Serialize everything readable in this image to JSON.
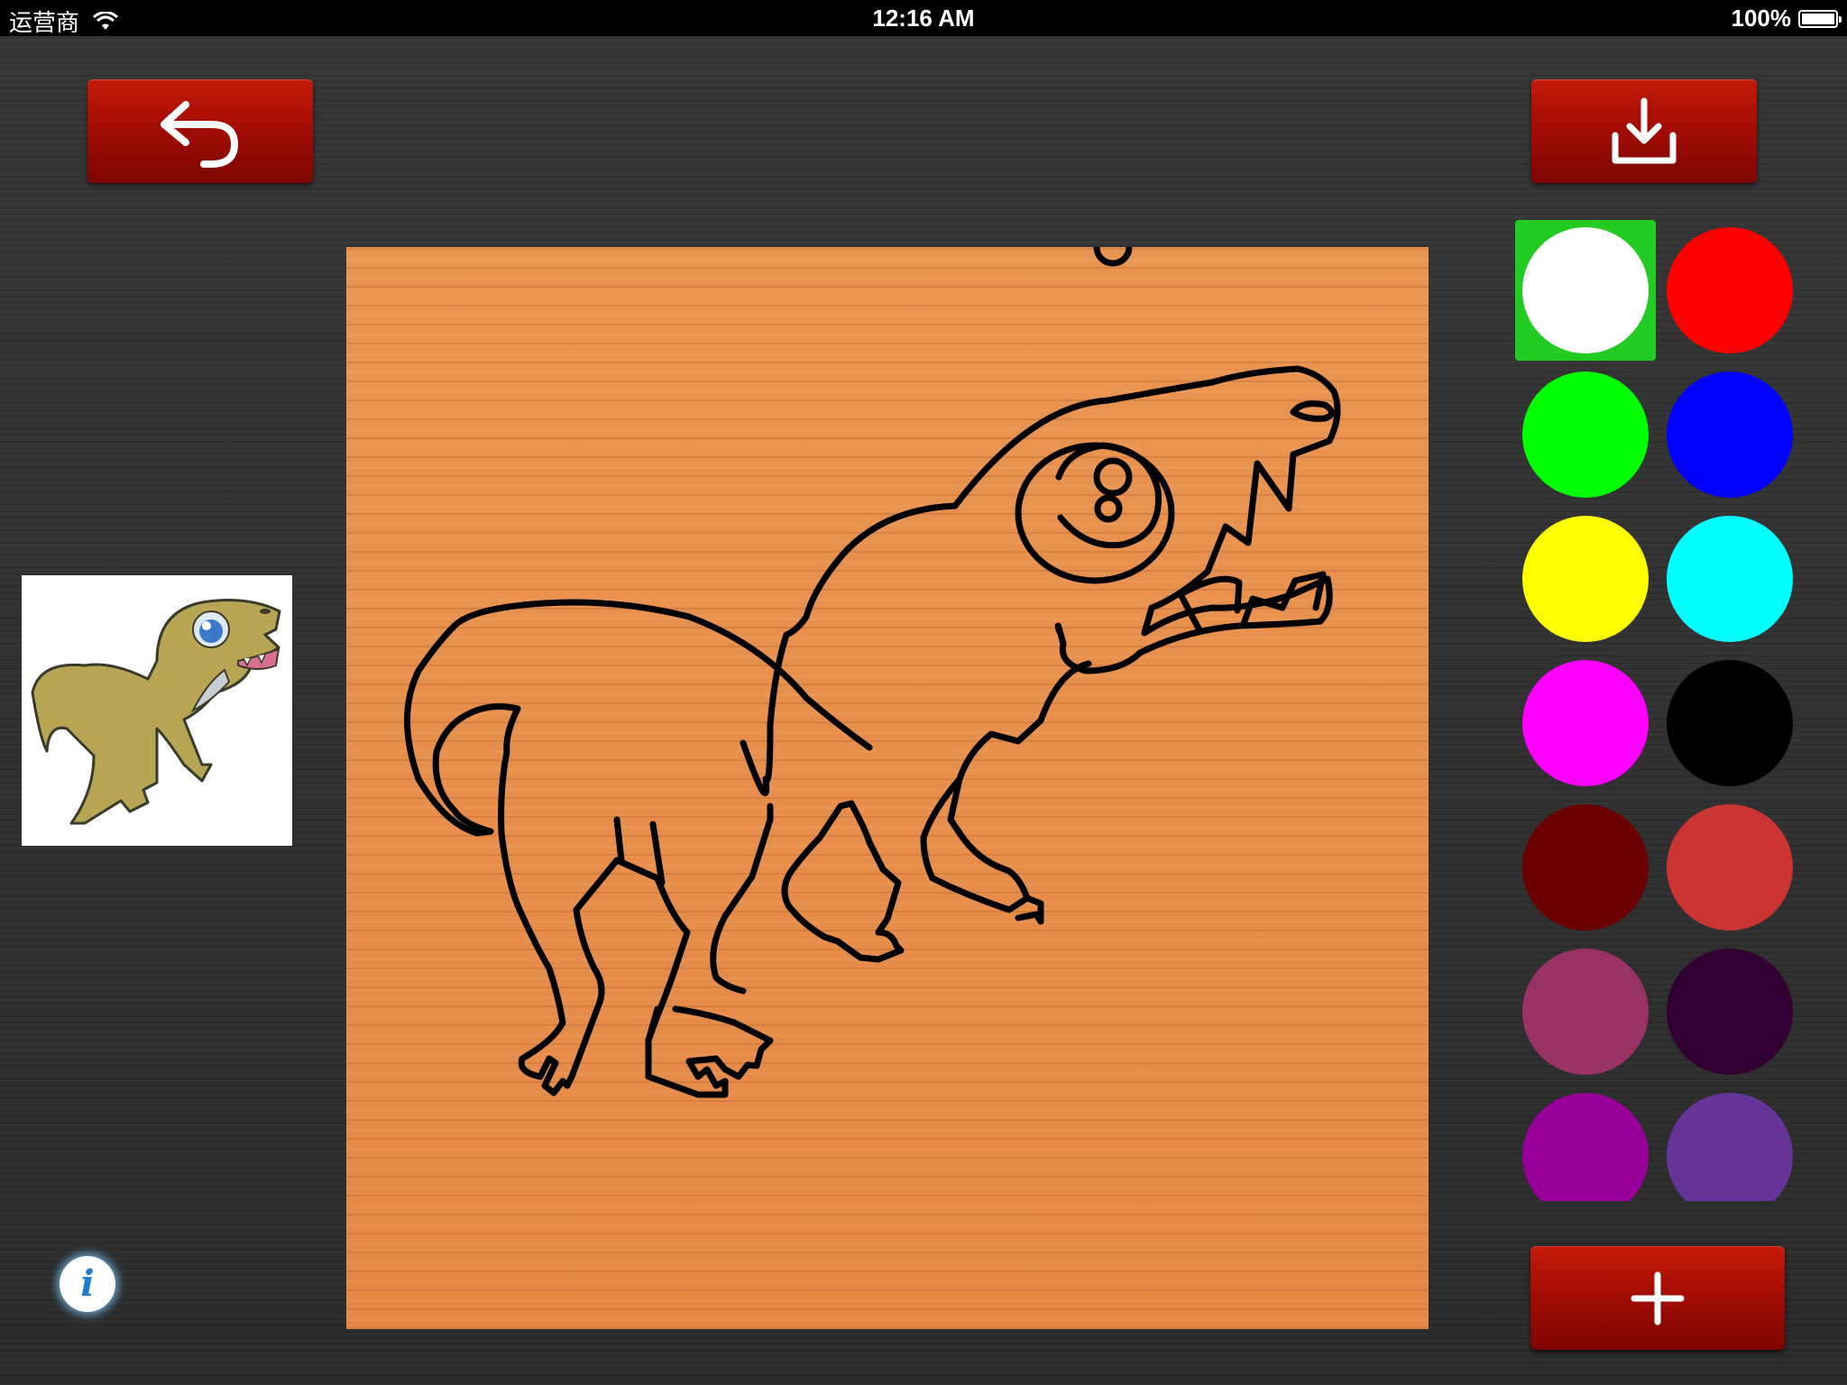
{
  "status_bar": {
    "carrier": "运营商",
    "time": "12:16 AM",
    "battery_percent": "100%",
    "battery_level": 1.0
  },
  "toolbar": {
    "undo_icon": "undo-arrow-icon",
    "save_icon": "download-icon",
    "add_icon": "plus-icon"
  },
  "info": {
    "label": "i"
  },
  "palette": {
    "selected_index": 0,
    "selected_highlight": "#22cc22",
    "colors": [
      "#ffffff",
      "#ff0000",
      "#00ff00",
      "#0000ff",
      "#ffff00",
      "#00ffff",
      "#ff00ff",
      "#000000",
      "#6a0000",
      "#cc3333",
      "#993366",
      "#330033",
      "#990099",
      "#663399"
    ]
  },
  "colors": {
    "button_red": "#b0120a",
    "canvas_wood": "#e58846",
    "background": "#2c2c2c"
  }
}
